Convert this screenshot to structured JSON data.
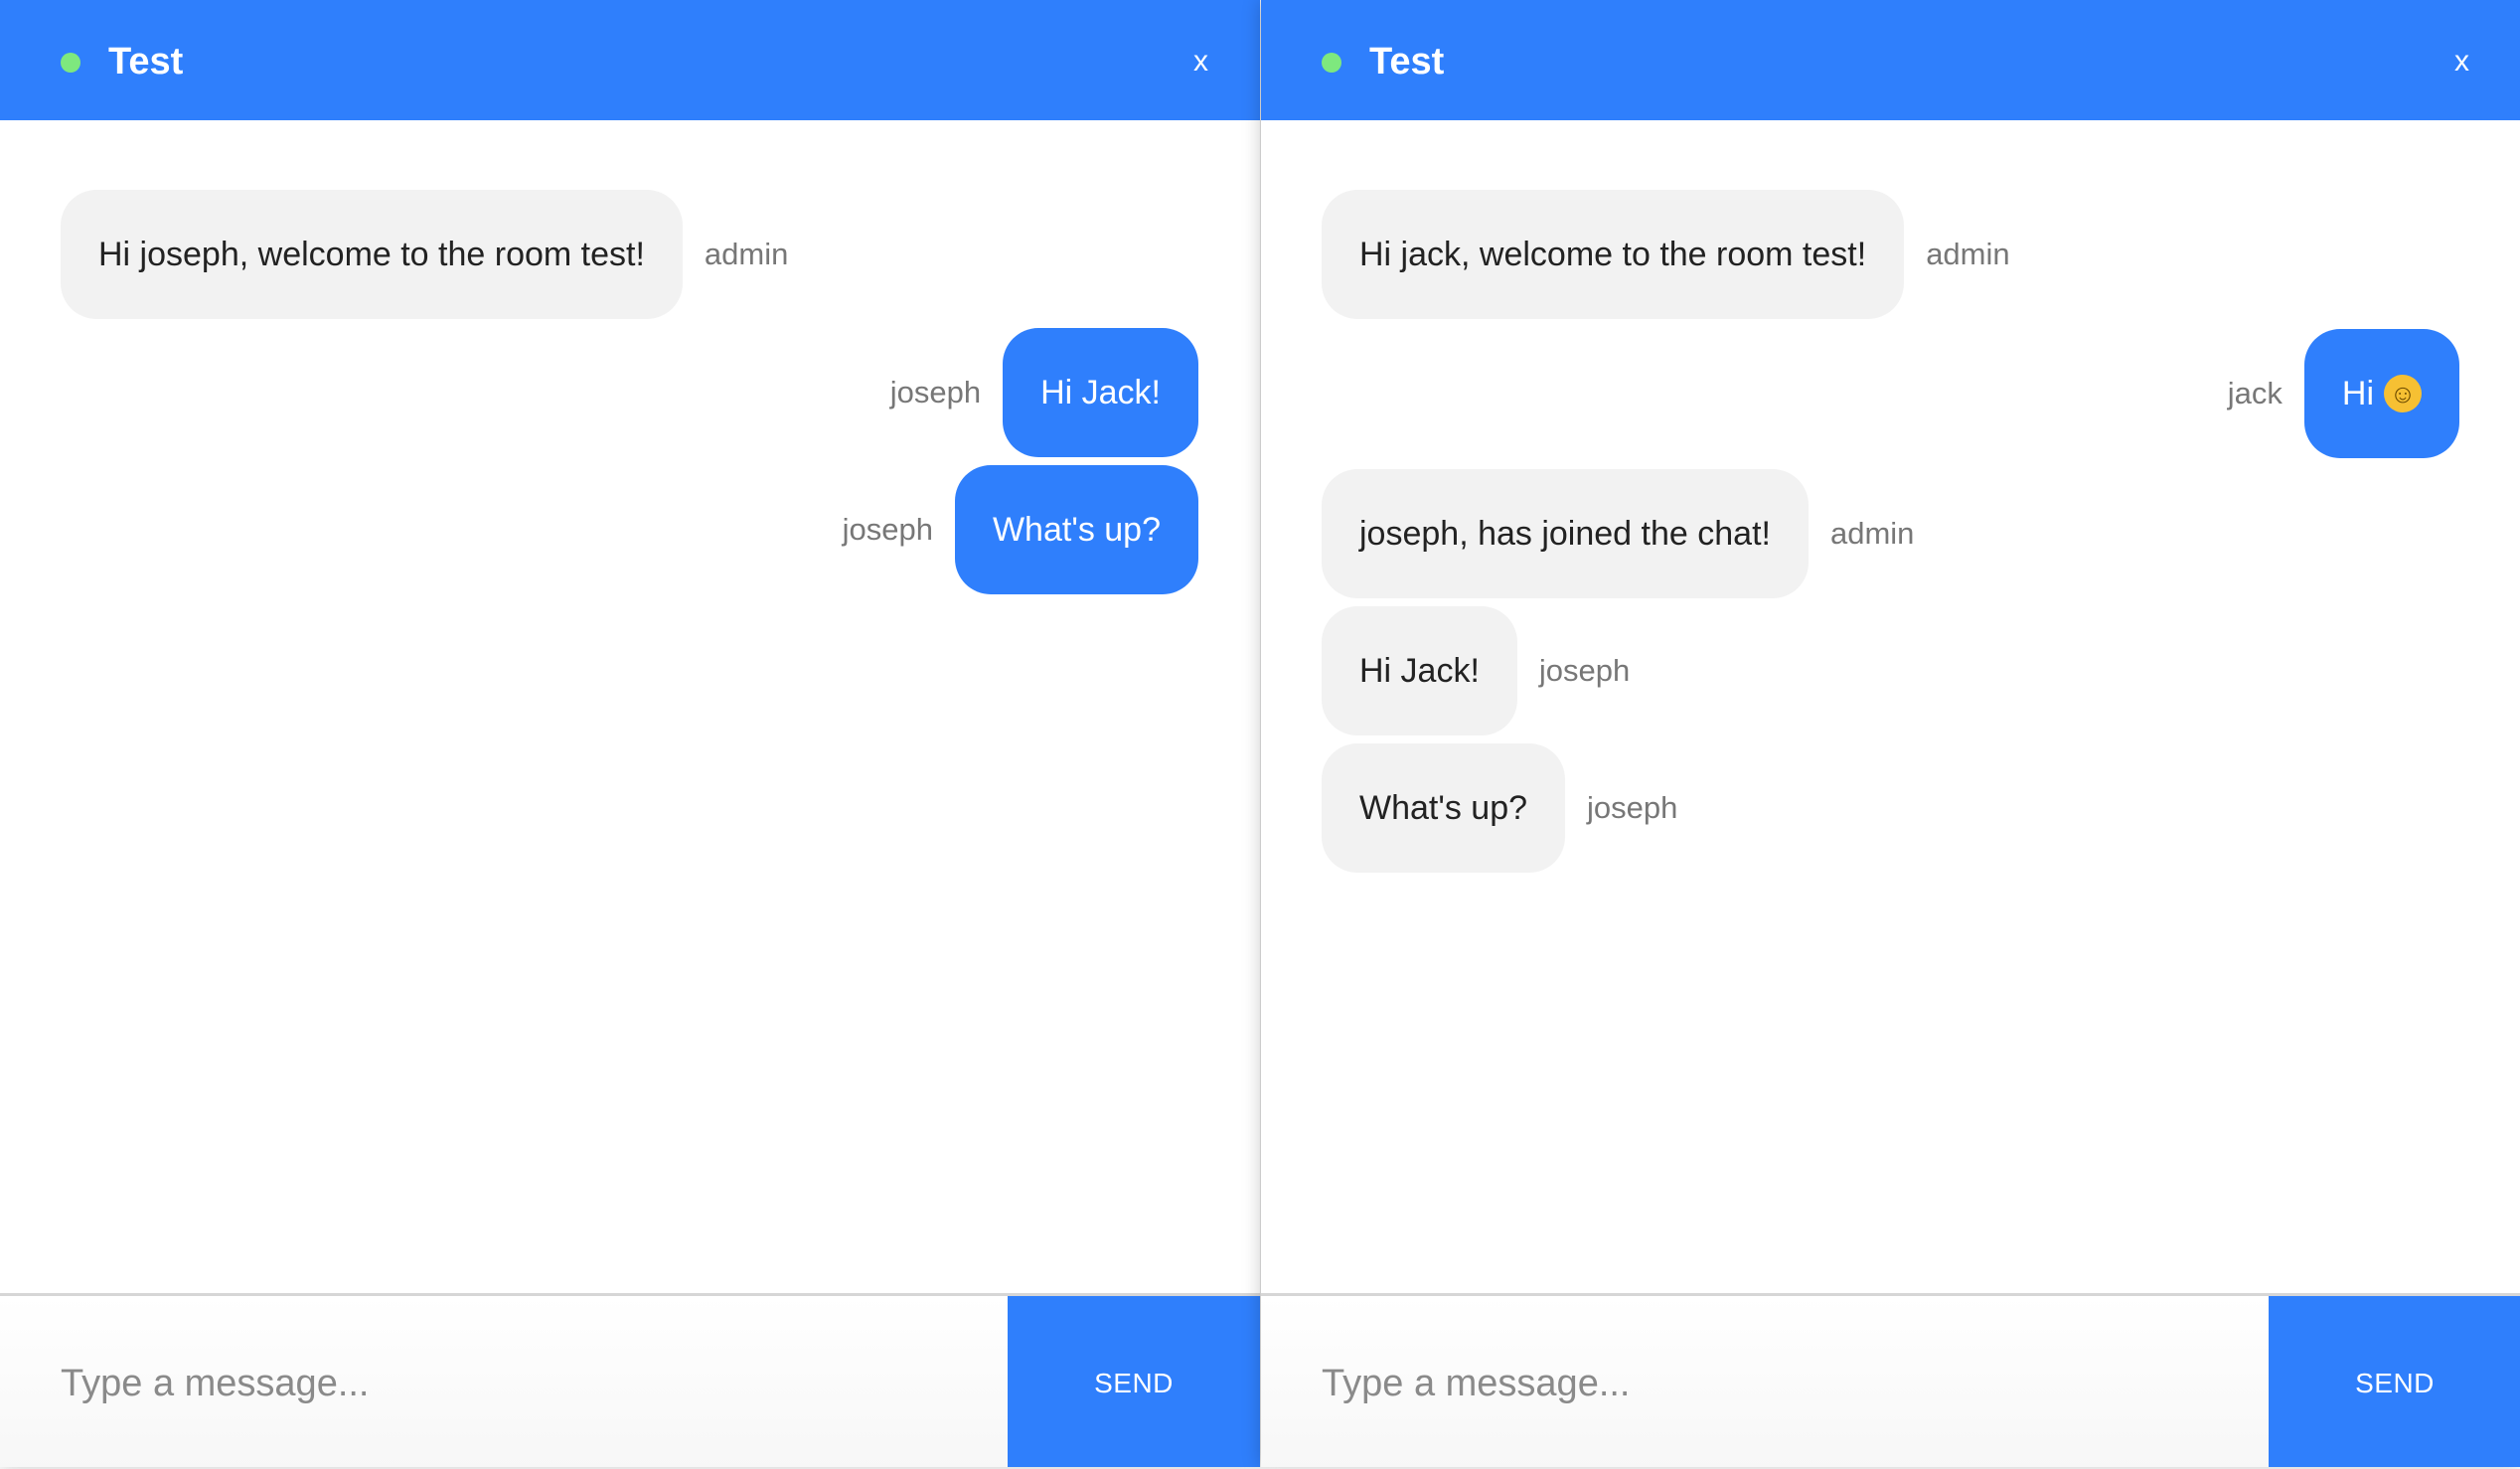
{
  "colors": {
    "accent": "#2f7ffc",
    "online_dot": "#7ee87e",
    "received_bubble": "#f2f2f2",
    "sender_text": "#777777"
  },
  "windows": [
    {
      "header": {
        "title": "Test",
        "close_label": "x",
        "status_icon": "online-dot-icon"
      },
      "messages": [
        {
          "text": "Hi joseph, welcome to the room test!",
          "sender": "admin",
          "own": false
        },
        {
          "text": "Hi Jack!",
          "sender": "joseph",
          "own": true
        },
        {
          "text": "What's up?",
          "sender": "joseph",
          "own": true
        }
      ],
      "composer": {
        "placeholder": "Type a message...",
        "send_label": "SEND"
      }
    },
    {
      "header": {
        "title": "Test",
        "close_label": "x",
        "status_icon": "online-dot-icon"
      },
      "messages": [
        {
          "text": "Hi jack, welcome to the room test!",
          "sender": "admin",
          "own": false
        },
        {
          "text": "Hi",
          "emoji": "smiley-face-icon",
          "emoji_glyph": "☺",
          "sender": "jack",
          "own": true
        },
        {
          "text": "joseph, has joined the chat!",
          "sender": "admin",
          "own": false
        },
        {
          "text": "Hi Jack!",
          "sender": "joseph",
          "own": false
        },
        {
          "text": "What's up?",
          "sender": "joseph",
          "own": false
        }
      ],
      "composer": {
        "placeholder": "Type a message...",
        "send_label": "SEND"
      }
    }
  ]
}
